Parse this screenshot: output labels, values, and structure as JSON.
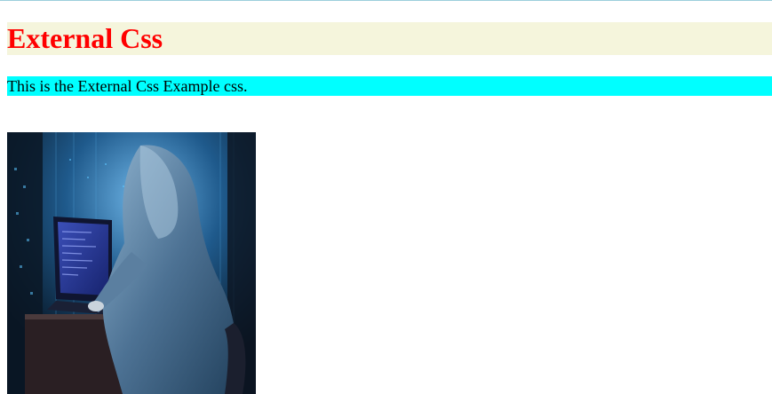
{
  "heading": "External Css",
  "paragraph": "This is the External Css Example css.",
  "image": {
    "alt": "hooded hacker at laptop in server room"
  },
  "colors": {
    "heading_text": "#ff0000",
    "heading_bg": "#f5f5dc",
    "paragraph_bg": "#00ffff",
    "top_rule": "#9ccfdc"
  }
}
